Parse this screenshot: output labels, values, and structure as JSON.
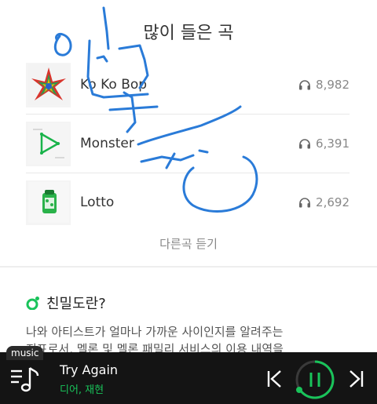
{
  "section": {
    "title": "많이 들은 곡"
  },
  "tracks": [
    {
      "title": "Ko Ko Bop",
      "plays": "8,982"
    },
    {
      "title": "Monster",
      "plays": "6,391"
    },
    {
      "title": "Lotto",
      "plays": "2,692"
    }
  ],
  "more_link": "다른곡 듣기",
  "info": {
    "heading": "친밀도란?",
    "body_line1": "나와 아티스트가 얼마나 가까운 사이인지를 알려주는",
    "body_line2": "지표로서, 멜론 및 멜론 패밀리 서비스의 이용 내역을"
  },
  "player": {
    "badge": "music",
    "song": "Try Again",
    "artist": "디어, 재현",
    "accent": "#19c35a"
  },
  "scribble_color": "#2a7bd8"
}
